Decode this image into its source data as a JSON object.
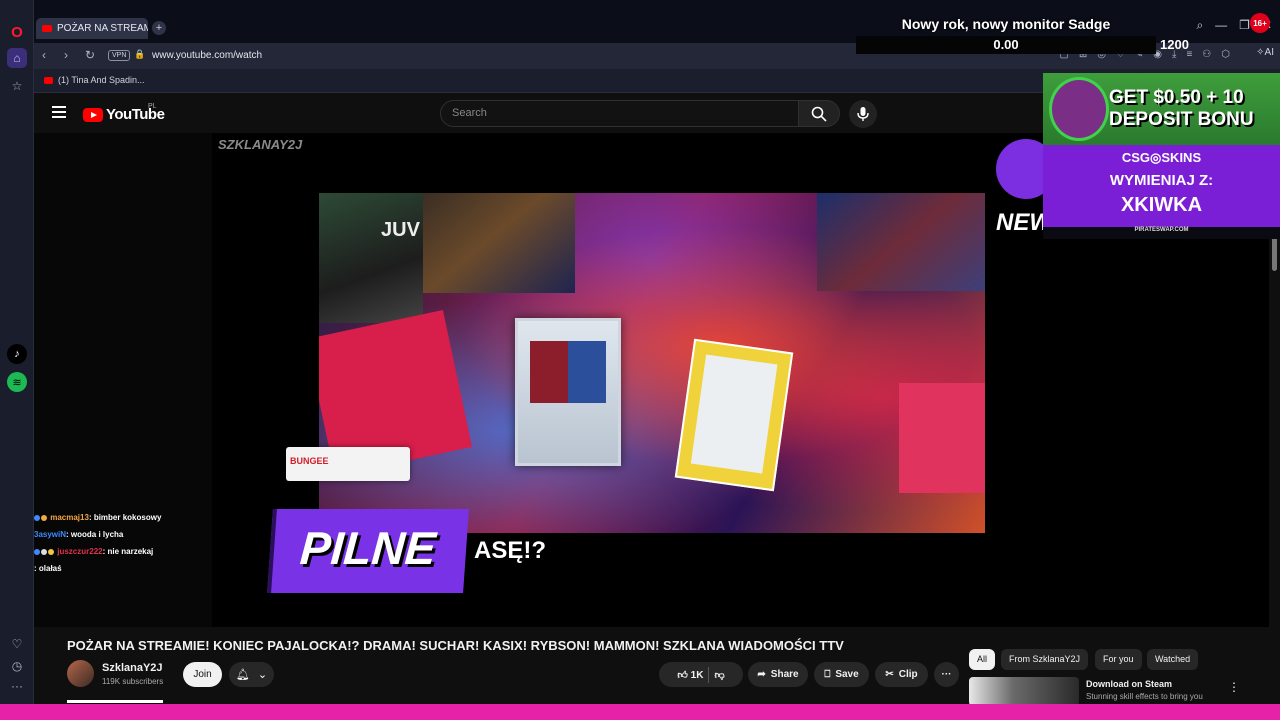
{
  "browser": {
    "tab_title": "POŻAR NA STREAMIE! KO",
    "new_tab": "+",
    "url": "www.youtube.com/watch",
    "vpn": "VPN",
    "ai_label": "AI",
    "bookmark_label": "(1) Tina And Spadin...",
    "notification_badge": "16+"
  },
  "overlay_goal": {
    "title": "Nowy rok, nowy monitor Sadge",
    "current": "0.00",
    "target": "1200"
  },
  "youtube": {
    "logo_text": "YouTube",
    "region": "PL",
    "search_placeholder": "Search"
  },
  "video": {
    "watermark": "SZKLANAY2J",
    "cam_text": "JUV",
    "sponsor": "BUNGEE",
    "banner": "PILNE",
    "banner_suffix": "ASĘ!?",
    "badge_text": "NEW",
    "chat": [
      {
        "user": "macmaj13",
        "message": ": bimber kokosowy"
      },
      {
        "user": "3asywiN",
        "message": ": wooda i lycha"
      },
      {
        "user": "juszczur222",
        "message": ": nie narzekaj"
      },
      {
        "user": "",
        "message": ": olałaś"
      }
    ]
  },
  "ad": {
    "headline1": "GET $0.50 + 10",
    "headline2": "DEPOSIT BONU",
    "brand": "CSG◎SKINS",
    "line1": "WYMIENIAJ Z:",
    "line2": "XKIWKA",
    "site": "PIRATESWAP.COM"
  },
  "meta": {
    "title": "POŻAR NA STREAMIE! KONIEC PAJALOCKA!? DRAMA! SUCHAR! KASIX! RYBSON! MAMMON! SZKLANA WIADOMOŚCI TTV",
    "channel": "SzklanaY2J",
    "subscribers": "119K subscribers",
    "join": "Join",
    "likes": "1K",
    "share": "Share",
    "save": "Save",
    "clip": "Clip"
  },
  "filters": [
    "All",
    "From SzklanaY2J",
    "For you",
    "Watched"
  ],
  "recommendation": {
    "title": "Download on Steam",
    "subtitle": "Stunning skill effects to bring you"
  },
  "colors": {
    "youtube_red": "#ff0000",
    "accent_purple": "#7a32e6",
    "bottom_bar": "#e623a8"
  }
}
